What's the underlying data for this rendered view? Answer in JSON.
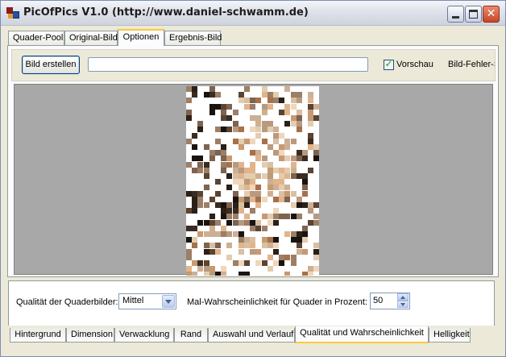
{
  "window": {
    "title": "PicOfPics V1.0 (http://www.daniel-schwamm.de)"
  },
  "top_tabs": [
    {
      "label": "Quader-Pool",
      "active": false
    },
    {
      "label": "Original-Bild",
      "active": false
    },
    {
      "label": "Optionen",
      "active": true
    },
    {
      "label": "Ergebnis-Bild",
      "active": false
    }
  ],
  "toolbar": {
    "create_label": "Bild erstellen",
    "preview_checked": true,
    "preview_label": "Vorschau",
    "error_label": "Bild-Fehler-S"
  },
  "options": {
    "quality_label": "Qualität der Quaderbilder:",
    "quality_value": "Mittel",
    "probability_label": "Mal-Wahrscheinlichkeit für Quader in Prozent:",
    "probability_value": "50"
  },
  "bottom_tabs": [
    {
      "label": "Hintergrund",
      "active": false
    },
    {
      "label": "Dimension",
      "active": false
    },
    {
      "label": "Verwacklung",
      "active": false
    },
    {
      "label": "Rand",
      "active": false
    },
    {
      "label": "Auswahl und Verlauf",
      "active": false
    },
    {
      "label": "Qualität und Wahrscheinlichkeit",
      "active": true
    },
    {
      "label": "Helligkeit",
      "active": false
    }
  ],
  "colors": {
    "active_tab_accent": "#ffc83c",
    "preview_background": "#a8a8a8"
  }
}
